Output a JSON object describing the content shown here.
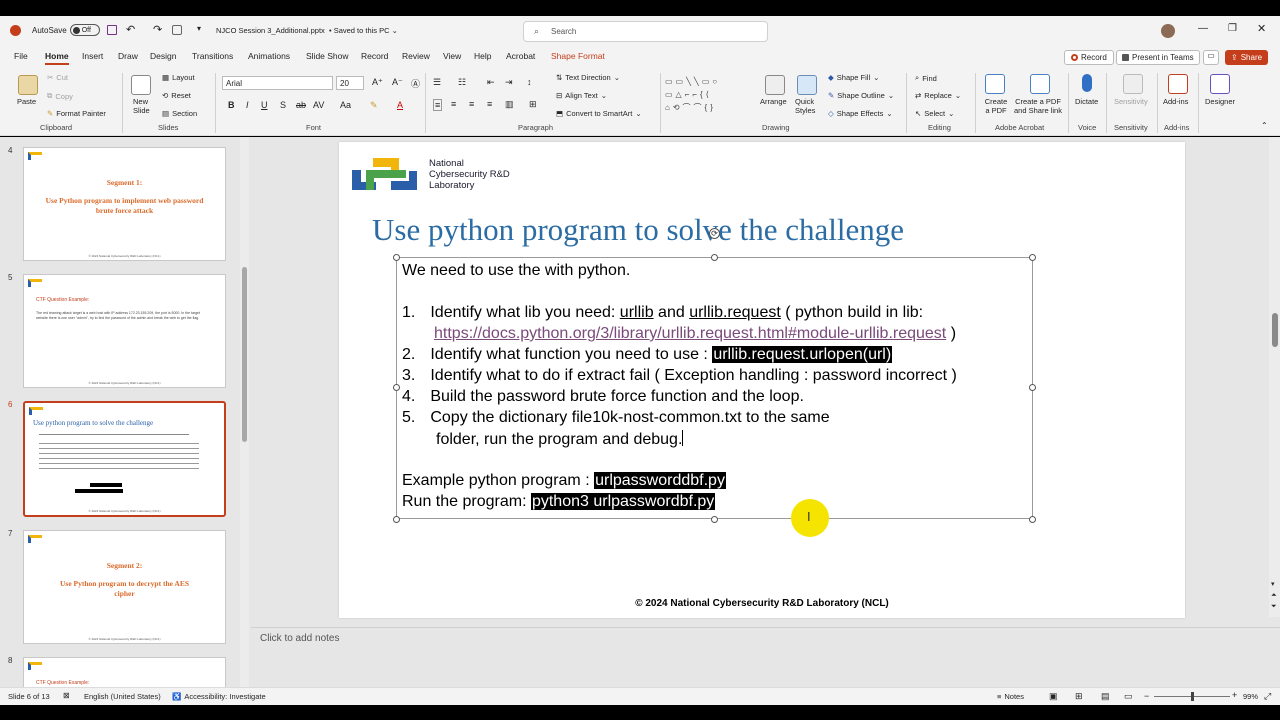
{
  "title_bar": {
    "app_icon": "powerpoint-icon",
    "autosave_label": "AutoSave",
    "autosave_state": "Off",
    "file_name": "NJCO Session 3_Additional.pptx",
    "save_state": "• Saved to this PC",
    "search_placeholder": "Search"
  },
  "menu": {
    "tabs": [
      "File",
      "Home",
      "Insert",
      "Draw",
      "Design",
      "Transitions",
      "Animations",
      "Slide Show",
      "Record",
      "Review",
      "View",
      "Help",
      "Acrobat",
      "Shape Format"
    ],
    "record_btn": "Record",
    "present_btn": "Present in Teams",
    "share_btn": "Share"
  },
  "ribbon": {
    "paste": "Paste",
    "cut": "Cut",
    "copy": "Copy",
    "format_painter": "Format Painter",
    "clipboard": "Clipboard",
    "new_slide": "New Slide",
    "layout": "Layout",
    "reset": "Reset",
    "section": "Section",
    "slides": "Slides",
    "font_name": "Arial",
    "font_size": "20",
    "font": "Font",
    "text_direction": "Text Direction",
    "align_text": "Align Text",
    "convert_smartart": "Convert to SmartArt",
    "paragraph": "Paragraph",
    "arrange": "Arrange",
    "quick_styles": "Quick Styles",
    "shape_fill": "Shape Fill",
    "shape_outline": "Shape Outline",
    "shape_effects": "Shape Effects",
    "drawing": "Drawing",
    "find": "Find",
    "replace": "Replace",
    "select": "Select",
    "editing": "Editing",
    "create_pdf": "Create a PDF",
    "create_share": "Create a PDF and Share link",
    "adobe": "Adobe Acrobat",
    "dictate": "Dictate",
    "voice": "Voice",
    "sensitivity": "Sensitivity",
    "sensitivity_group": "Sensitivity",
    "addins": "Add-ins",
    "addins_group": "Add-ins",
    "designer": "Designer"
  },
  "thumbnails": [
    {
      "num": "4",
      "title": "Segment 1:",
      "subtitle": "Use Python program to implement web password brute force attack",
      "footer": "© 2024 National Cybersecurity R&D Laboratory (NCL)"
    },
    {
      "num": "5",
      "title": "CTF Question Example:",
      "text": "The red teaming attack target is a web host with IP address 172.23.155.209, the port is 5000. In the target website there is one user \"admin\", try to find the password of the admin and break the web to get the flag.",
      "footer": "© 2024 National Cybersecurity R&D Laboratory (NCL)"
    },
    {
      "num": "6",
      "title": "Use python program to solve the challenge",
      "footer": "© 2024 National Cybersecurity R&D Laboratory (NCL)"
    },
    {
      "num": "7",
      "title": "Segment 2:",
      "subtitle": "Use Python program to decrypt the AES cipher",
      "footer": "© 2024 National Cybersecurity R&D Laboratory (NCL)"
    },
    {
      "num": "8",
      "title": "CTF Question Example:"
    }
  ],
  "slide": {
    "logo_lines": [
      "National",
      "Cybersecurity R&D",
      "Laboratory"
    ],
    "title": "Use python program to solve the challenge",
    "intro": "We need to use the with python.",
    "items": [
      {
        "n": "1.",
        "pre": "Identify what lib you need: ",
        "u1": "urllib",
        "mid": " and ",
        "u2": "urllib.request",
        "post": " ( python build in lib:"
      },
      {
        "link": "https://docs.python.org/3/library/urllib.request.html#module-urllib.request",
        "post": " )"
      },
      {
        "n": "2.",
        "pre": "Identify what function you need to use : ",
        "code": "urllib.request.urlopen(url)"
      },
      {
        "n": "3.",
        "pre": "Identify what to do if extract fail ( Exception handling : password incorrect )"
      },
      {
        "n": "4.",
        "pre": "Build the password brute force function and the loop."
      },
      {
        "n": "5.",
        "pre": "Copy the dictionary file10k-nost-common.txt to the same"
      },
      {
        "pre": "folder, run the program and debug."
      }
    ],
    "example_label": "Example python program : ",
    "example_code": "urlpassworddbf.py",
    "run_label": "Run the program: ",
    "run_code": "python3 urlpasswordbf.py",
    "footer": "© 2024 National Cybersecurity R&D Laboratory (NCL)"
  },
  "notes_placeholder": "Click to add notes",
  "status": {
    "slide": "Slide 6 of 13",
    "language": "English (United States)",
    "accessibility": "Accessibility: Investigate",
    "notes": "Notes",
    "zoom": "99%"
  }
}
